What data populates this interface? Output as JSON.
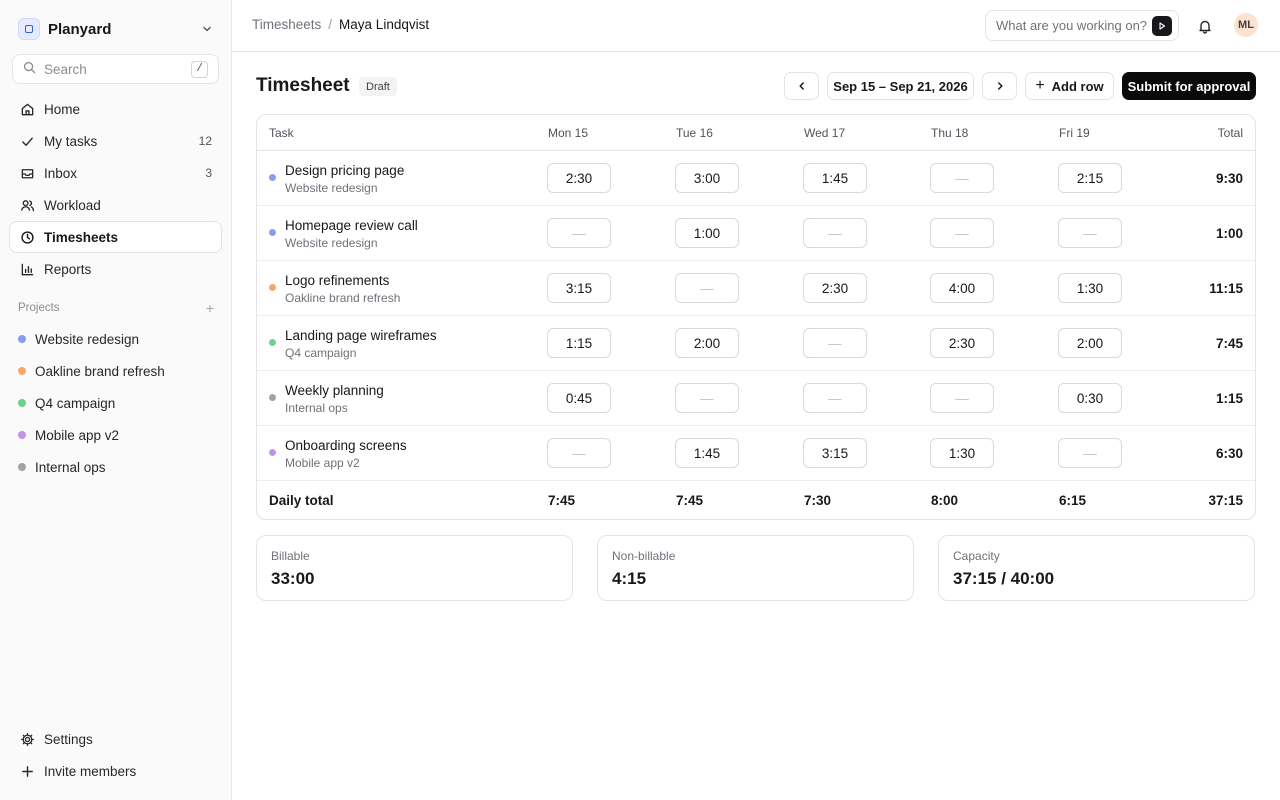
{
  "workspace": {
    "name": "Planyard"
  },
  "search": {
    "placeholder": "Search",
    "shortcut": "/"
  },
  "nav": [
    {
      "label": "Home",
      "icon": "home-icon",
      "count": ""
    },
    {
      "label": "My tasks",
      "icon": "check-icon",
      "count": "12"
    },
    {
      "label": "Inbox",
      "icon": "inbox-icon",
      "count": "3"
    },
    {
      "label": "Workload",
      "icon": "users-icon",
      "count": ""
    },
    {
      "label": "Timesheets",
      "icon": "clock-icon",
      "count": "",
      "active": true
    },
    {
      "label": "Reports",
      "icon": "bar-chart-icon",
      "count": ""
    }
  ],
  "projects_header": "Projects",
  "projects": [
    {
      "label": "Website redesign",
      "color": "#8b9cf0"
    },
    {
      "label": "Oakline brand refresh",
      "color": "#f2a86b"
    },
    {
      "label": "Q4 campaign",
      "color": "#6fcf8c"
    },
    {
      "label": "Mobile app v2",
      "color": "#c294e8"
    },
    {
      "label": "Internal ops",
      "color": "#a1a1aa"
    }
  ],
  "bottom_nav": [
    {
      "label": "Settings",
      "icon": "gear-icon"
    },
    {
      "label": "Invite members",
      "icon": "plus-icon"
    }
  ],
  "breadcrumb": {
    "parent": "Timesheets",
    "separator": "/",
    "current": "Maya Lindqvist"
  },
  "ask": {
    "placeholder": "What are you working on?"
  },
  "user": {
    "initials": "ML"
  },
  "page": {
    "title": "Timesheet",
    "status": "Draft",
    "range": "Sep 15 – Sep 21, 2026",
    "add_row": "Add row",
    "submit": "Submit for approval"
  },
  "table": {
    "headers": [
      "Task",
      "Mon 15",
      "Tue 16",
      "Wed 17",
      "Thu 18",
      "Fri 19",
      "Total"
    ],
    "rows": [
      {
        "task": "Design pricing page",
        "project": "Website redesign",
        "color": "#8b9cf0",
        "hours": [
          "2:30",
          "3:00",
          "1:45",
          "—",
          "2:15"
        ],
        "total": "9:30"
      },
      {
        "task": "Homepage review call",
        "project": "Website redesign",
        "color": "#8b9cf0",
        "hours": [
          "—",
          "1:00",
          "—",
          "—",
          "—"
        ],
        "total": "1:00"
      },
      {
        "task": "Logo refinements",
        "project": "Oakline brand refresh",
        "color": "#f2a86b",
        "hours": [
          "3:15",
          "—",
          "2:30",
          "4:00",
          "1:30"
        ],
        "total": "11:15"
      },
      {
        "task": "Landing page wireframes",
        "project": "Q4 campaign",
        "color": "#6fcf8c",
        "hours": [
          "1:15",
          "2:00",
          "—",
          "2:30",
          "2:00"
        ],
        "total": "7:45"
      },
      {
        "task": "Weekly planning",
        "project": "Internal ops",
        "color": "#a1a1aa",
        "hours": [
          "0:45",
          "—",
          "—",
          "—",
          "0:30"
        ],
        "total": "1:15"
      },
      {
        "task": "Onboarding screens",
        "project": "Mobile app v2",
        "color": "#c294e8",
        "hours": [
          "—",
          "1:45",
          "3:15",
          "1:30",
          "—"
        ],
        "total": "6:30"
      }
    ],
    "footer": {
      "label": "Daily total",
      "values": [
        "7:45",
        "7:45",
        "7:30",
        "8:00",
        "6:15"
      ],
      "total": "37:15"
    }
  },
  "stats": [
    {
      "label": "Billable",
      "value": "33:00"
    },
    {
      "label": "Non-billable",
      "value": "4:15"
    },
    {
      "label": "Capacity",
      "value": "37:15 / 40:00"
    }
  ]
}
